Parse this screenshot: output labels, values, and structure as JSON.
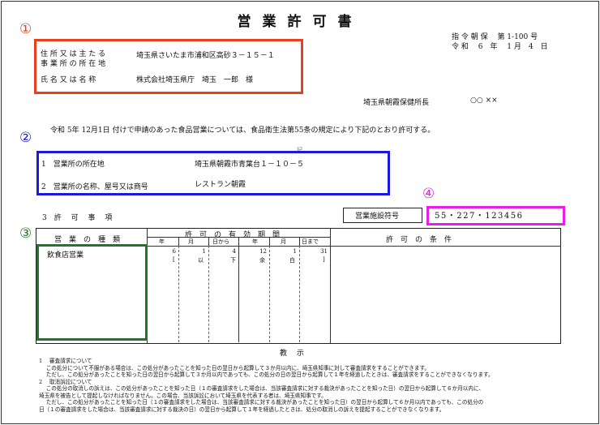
{
  "document": {
    "title": "営業許可書",
    "ref_number": "指 令 朝 保　 第 1-100 号",
    "date": "令 和　 6　年　 1 月　4　日",
    "issuer": "埼玉県朝霞保健所長",
    "issuer_seal": "○○ ××",
    "body_text": "令和 5年 12月1日 付けで申請のあった食品営業については、食品衛生法第55条の規定により下記のとおり許可する。",
    "ki": "記"
  },
  "markers": {
    "m1": "①",
    "m2": "②",
    "m3": "③",
    "m4": "④"
  },
  "applicant": {
    "address_label_1": "住 所 又 は 主 た る",
    "address_label_2": "事 業 所 の 所 在 地",
    "address_value": "埼玉県さいたま市浦和区高砂３－１５－１",
    "name_label": "氏 名 又 は 名 称",
    "name_value": "株式会社埼玉県庁　埼玉　一郎　様"
  },
  "business": {
    "location_label": "1　営業所の所在地",
    "location_value": "埼玉県朝霞市青葉台１－１０－５",
    "name_label": "2　営業所の名称、屋号又は商号",
    "name_value": "レストラン朝霞"
  },
  "permit_section": {
    "label": "3　許　 可　 事　 項",
    "facility_code_label": "営業施設符号",
    "facility_code_value": "55・227・123456"
  },
  "table": {
    "col_type": "営　業　の　種　類",
    "col_period": "許　可　の　有　効　期　間",
    "col_conditions": "許　可　の　条　件",
    "sub_year1": "年",
    "sub_month1": "月",
    "sub_day_from": "日から",
    "sub_year2": "年",
    "sub_month2": "月",
    "sub_day_to": "日まで",
    "row_type": "飲食店営業",
    "from_year": "6",
    "from_month": "1",
    "from_day": "4",
    "to_year": "12",
    "to_month": "1",
    "to_day": "31",
    "bracket_open": "[",
    "bracket_close": "]",
    "kanji_1": "以",
    "kanji_2": "下",
    "kanji_3": "余",
    "kanji_4": "白"
  },
  "notice": {
    "heading": "教　 示",
    "lines": [
      "1　 審査請求について",
      "　 この処分について不服がある場合は、この処分があったことを知った日の翌日から起算して３か月以内に、埼玉県知事に対して審査請求をすることができます。",
      "　 ただし、この処分があったことを知った日の翌日から起算して３か月以内であっても、この処分の日の翌日から起算して１年を経過したときは、審査請求をすることができなくなります。",
      "2　 取消訴訟について",
      "　 この処分の取消しの訴えは、この処分があったことを知った日（１の審査請求をした場合は、当該審査請求に対する裁決があったことを知った日）の翌日から起算して６か月以内に、",
      "埼玉県を被告として提起しなければなりません。この場合、当該訴訟において埼玉県を代表する者は、埼玉県知事です。",
      "　 ただし、この処分があったことを知った日（１の審査請求をした場合は、当該審査請求に対する裁決があったことを知った日）の翌日から起算して６か月以内であっても、この処分の",
      "日（１の審査請求をした場合は、当該審査請求に対する裁決の日）の翌日から起算して１年を経過したときは、処分の取消しの訴えを提起することができなくなります。"
    ]
  },
  "colors": {
    "marker_red": "#e8401c",
    "marker_blue": "#1a1adf",
    "marker_green": "#1e7a22",
    "marker_magenta": "#e61ee6"
  }
}
